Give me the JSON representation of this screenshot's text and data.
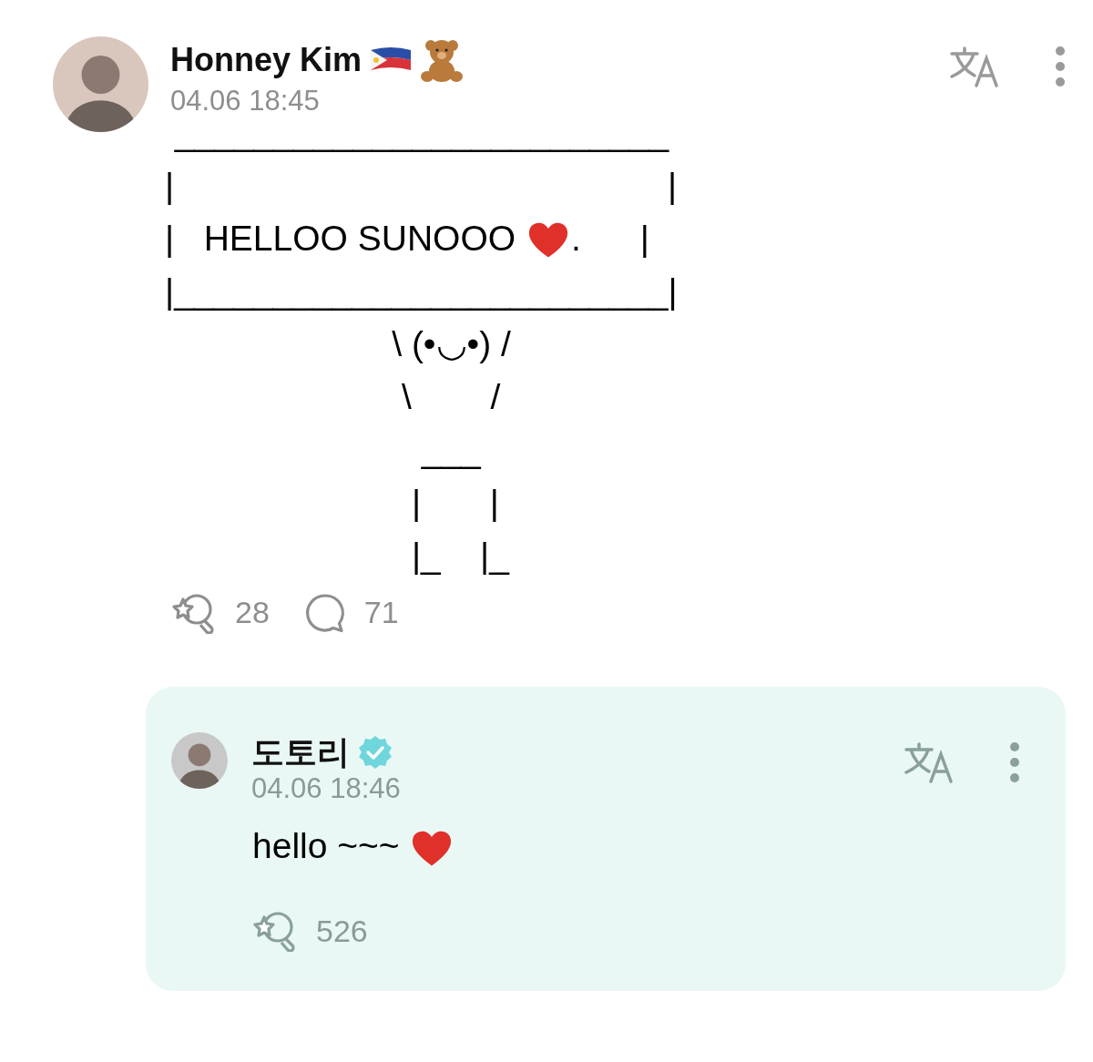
{
  "post": {
    "author": "Honney Kim",
    "date": "04.06 18:45",
    "art_lines": [
      [
        {
          "kind": "text",
          "text": " _________________________"
        }
      ],
      [
        {
          "kind": "text",
          "text": "|                                                  |"
        }
      ],
      [
        {
          "kind": "text",
          "text": "|   HELLOO SUNOOO "
        },
        {
          "kind": "heart"
        },
        {
          "kind": "text",
          "text": ".      |"
        }
      ],
      [
        {
          "kind": "text",
          "text": "|_________________________|"
        }
      ],
      [
        {
          "kind": "text",
          "text": "                       \\ (•◡•) /"
        }
      ],
      [
        {
          "kind": "text",
          "text": "                        \\        /"
        }
      ],
      [
        {
          "kind": "text",
          "text": "                          ___"
        }
      ],
      [
        {
          "kind": "text",
          "text": "                         |       |"
        }
      ],
      [
        {
          "kind": "text",
          "text": "                         |_    |_"
        }
      ]
    ],
    "reactions": [
      {
        "kind": "like",
        "count": "28"
      },
      {
        "kind": "comment",
        "count": "71"
      }
    ]
  },
  "reply": {
    "author": "도토리",
    "verified": true,
    "date": "04.06 18:46",
    "body": [
      {
        "kind": "text",
        "text": "hello ~~~ "
      },
      {
        "kind": "heart"
      }
    ],
    "reactions": [
      {
        "kind": "like",
        "count": "526"
      }
    ]
  }
}
